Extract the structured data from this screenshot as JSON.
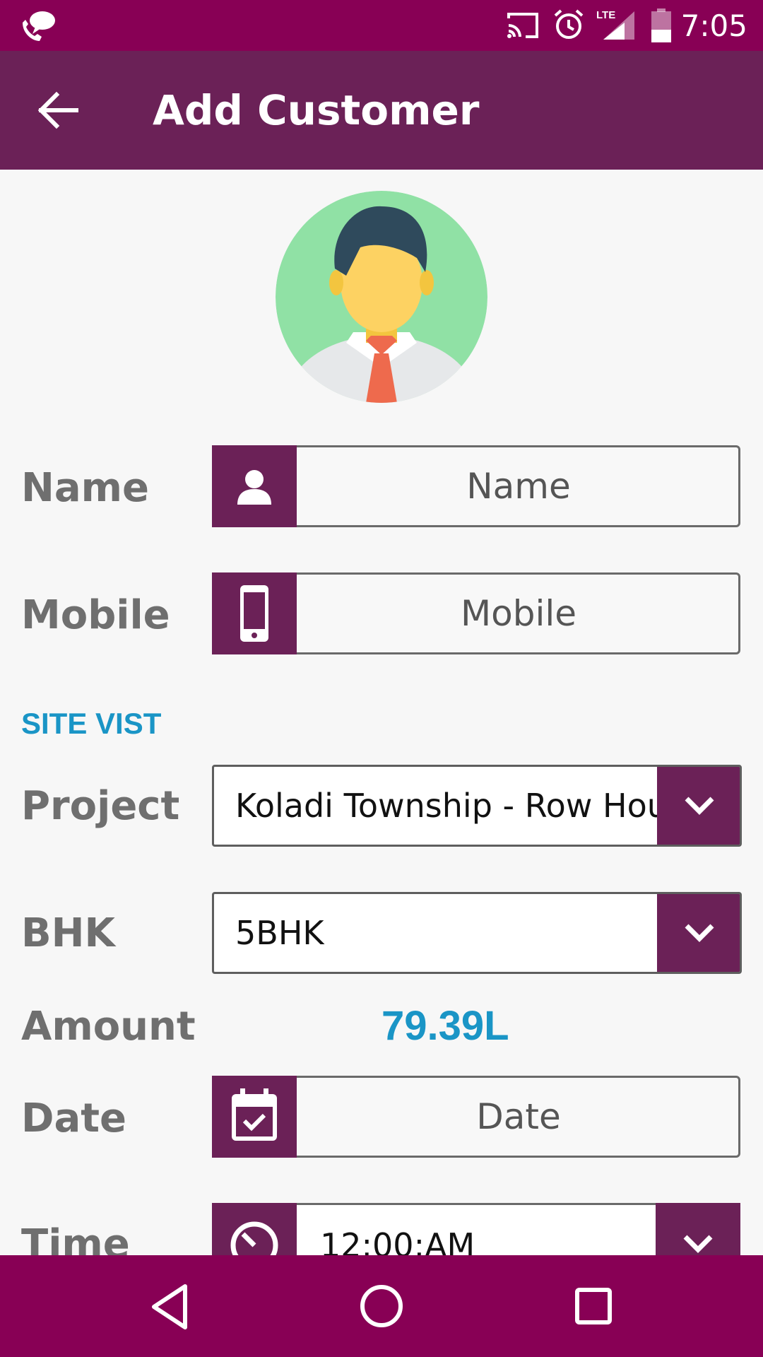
{
  "status_bar": {
    "time": "7:05",
    "icons": [
      "chat-phone-icon",
      "cast-icon",
      "alarm-icon",
      "lte-signal-icon",
      "battery-icon"
    ]
  },
  "app_bar": {
    "title": "Add Customer",
    "back_icon": "arrow-back-icon",
    "color": "#6b2157"
  },
  "form": {
    "name_label": "Name",
    "name_placeholder": "Name",
    "mobile_label": "Mobile",
    "mobile_placeholder": "Mobile",
    "section_title": "SITE VIST",
    "project_label": "Project",
    "project_value": "Koladi Township - Row House",
    "bhk_label": "BHK",
    "bhk_value": "5BHK",
    "amount_label": "Amount",
    "amount_value": "79.39L",
    "date_label": "Date",
    "date_placeholder": "Date",
    "time_label": "Time",
    "time_value": "12:00:AM"
  },
  "colors": {
    "status_bar": "#880055",
    "accent": "#6b2157",
    "highlight": "#1a95c6"
  }
}
